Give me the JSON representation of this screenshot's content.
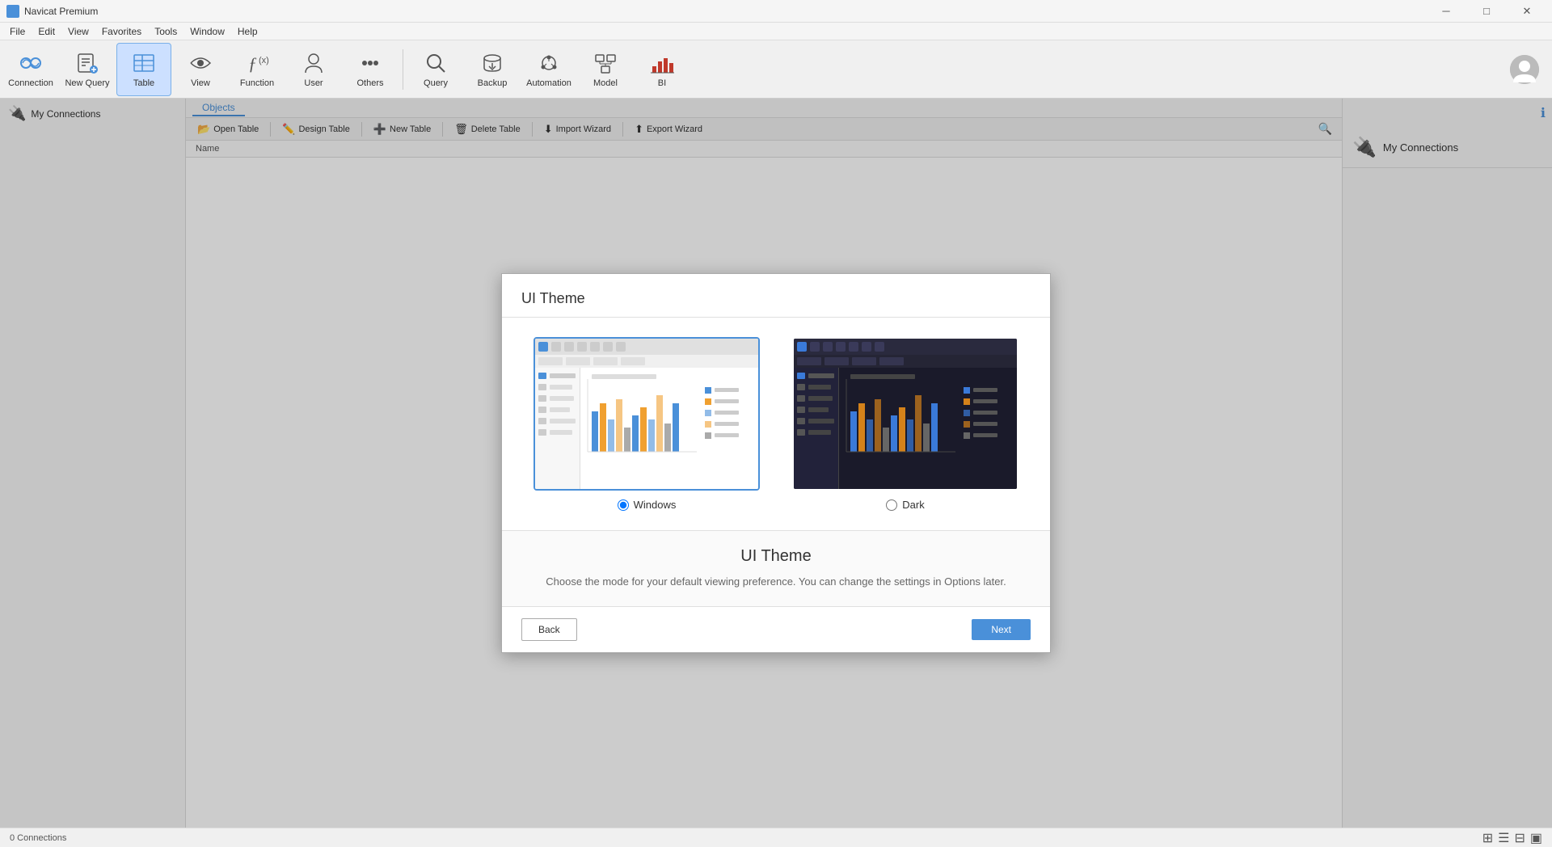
{
  "app": {
    "title": "Navicat Premium",
    "icon": "🐬"
  },
  "titlebar": {
    "minimize": "─",
    "maximize": "□",
    "close": "✕"
  },
  "menubar": {
    "items": [
      "File",
      "Edit",
      "View",
      "Favorites",
      "Tools",
      "Window",
      "Help"
    ]
  },
  "toolbar": {
    "buttons": [
      {
        "id": "connection",
        "label": "Connection",
        "icon": "🔌"
      },
      {
        "id": "new-query",
        "label": "New Query",
        "icon": "📝"
      },
      {
        "id": "table",
        "label": "Table",
        "icon": "📋",
        "active": true
      },
      {
        "id": "view",
        "label": "View",
        "icon": "👁"
      },
      {
        "id": "function",
        "label": "Function",
        "icon": "ƒ"
      },
      {
        "id": "user",
        "label": "User",
        "icon": "👤"
      },
      {
        "id": "others",
        "label": "Others",
        "icon": "⋯"
      },
      {
        "id": "query",
        "label": "Query",
        "icon": "🔍"
      },
      {
        "id": "backup",
        "label": "Backup",
        "icon": "💾"
      },
      {
        "id": "automation",
        "label": "Automation",
        "icon": "🤖"
      },
      {
        "id": "model",
        "label": "Model",
        "icon": "🗂"
      },
      {
        "id": "bi",
        "label": "BI",
        "icon": "📊"
      }
    ]
  },
  "sidebar": {
    "connections_label": "My Connections"
  },
  "objects_bar": {
    "tab": "Objects"
  },
  "action_bar": {
    "open_table": "Open Table",
    "design_table": "Design Table",
    "new_table": "New Table",
    "delete_table": "Delete Table",
    "import_wizard": "Import Wizard",
    "export_wizard": "Export Wizard"
  },
  "name_column": "Name",
  "right_panel": {
    "my_connections": "My Connections"
  },
  "dialog": {
    "title": "UI Theme",
    "themes": [
      {
        "id": "windows",
        "label": "Windows",
        "selected": true
      },
      {
        "id": "dark",
        "label": "Dark",
        "selected": false
      }
    ],
    "info_title": "UI Theme",
    "info_text": "Choose the mode for your default viewing preference. You can change the settings in Options later.",
    "back_label": "Back",
    "next_label": "Next"
  },
  "statusbar": {
    "connections": "0 Connections"
  }
}
